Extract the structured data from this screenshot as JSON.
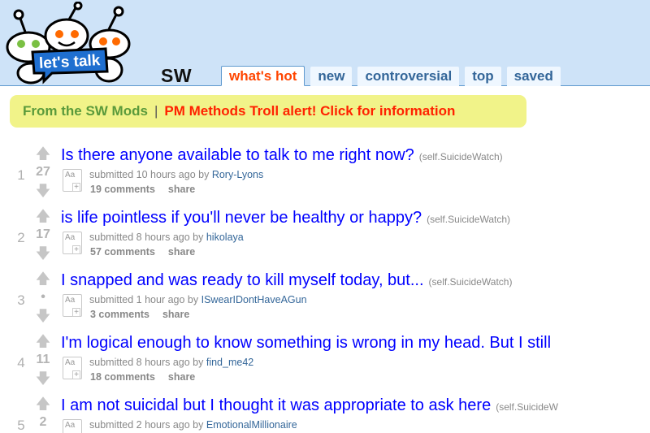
{
  "header": {
    "logo_text": "let's talk",
    "subreddit": "SW",
    "tabs": [
      {
        "label": "what's hot",
        "selected": true
      },
      {
        "label": "new"
      },
      {
        "label": "controversial"
      },
      {
        "label": "top"
      },
      {
        "label": "saved"
      }
    ]
  },
  "announcement": {
    "mods": "From the SW Mods",
    "separator": "|",
    "alert": "PM Methods Troll alert! Click for information"
  },
  "colors": {
    "header_bg": "#cee3f8",
    "title_link": "#0000ff",
    "selected_tab": "#ff4500",
    "announce_bg": "#f1f389",
    "mods_text": "#5a9a3b",
    "alert_text": "#ff2200"
  },
  "posts": [
    {
      "rank": "1",
      "score": "27",
      "title": "Is there anyone available to talk to me right now?",
      "domain": "(self.SuicideWatch)",
      "submitted": "submitted 10 hours ago by",
      "author": "Rory-Lyons",
      "comments": "19 comments",
      "share": "share"
    },
    {
      "rank": "2",
      "score": "17",
      "title": "is life pointless if you'll never be healthy or happy?",
      "domain": "(self.SuicideWatch)",
      "submitted": "submitted 8 hours ago by",
      "author": "hikolaya",
      "comments": "57 comments",
      "share": "share"
    },
    {
      "rank": "3",
      "score": "•",
      "title": "I snapped and was ready to kill myself today, but...",
      "domain": "(self.SuicideWatch)",
      "submitted": "submitted 1 hour ago by",
      "author": "ISwearIDontHaveAGun",
      "comments": "3 comments",
      "share": "share"
    },
    {
      "rank": "4",
      "score": "11",
      "title": "I'm logical enough to know something is wrong in my head. But I still",
      "domain": "",
      "submitted": "submitted 8 hours ago by",
      "author": "find_me42",
      "comments": "18 comments",
      "share": "share"
    },
    {
      "rank": "5",
      "score": "2",
      "title": "I am not suicidal but I thought it was appropriate to ask here",
      "domain": "(self.SuicideW",
      "submitted": "submitted 2 hours ago by",
      "author": "EmotionalMillionaire",
      "comments": "",
      "share": ""
    }
  ],
  "icons": {
    "upvote": "arrow-up-icon",
    "downvote": "arrow-down-icon",
    "thumbnail": "text-post-thumbnail-icon",
    "logo": "reddit-alien-mascots-logo"
  }
}
